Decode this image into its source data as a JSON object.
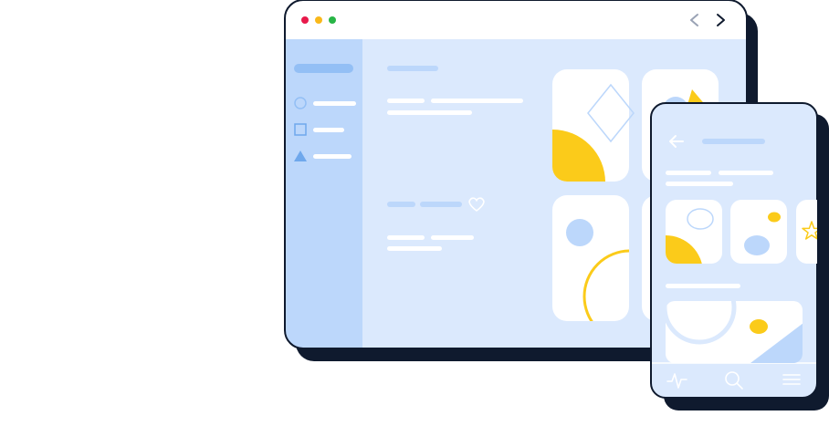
{
  "illustration": {
    "colors": {
      "outline": "#0f1a2e",
      "shadow": "#0f1a2e",
      "background": "#dbe9fd",
      "sidebar": "#bcd7fb",
      "sidebar_active": "#93bff5",
      "placeholder_bar": "#ffffff",
      "muted_bar": "#bcd7fb",
      "card": "#ffffff",
      "accent_yellow": "#fbcb1a",
      "accent_blue": "#bcd7fb",
      "dot_red": "#e8194b",
      "dot_yellow": "#f9b81a",
      "dot_green": "#28b546"
    },
    "desktop_window": {
      "titlebar_dots": [
        "red-dot",
        "yellow-dot",
        "green-dot"
      ],
      "nav_icons": [
        "chevron-left-icon",
        "chevron-right-icon"
      ],
      "sidebar_icons": [
        "circle-icon",
        "square-icon",
        "triangle-icon"
      ],
      "content_icons": [
        "heart-icon"
      ]
    },
    "mobile_window": {
      "header_icons": [
        "back-arrow-icon"
      ],
      "tabbar_icons": [
        "activity-icon",
        "search-icon",
        "menu-icon"
      ]
    }
  }
}
